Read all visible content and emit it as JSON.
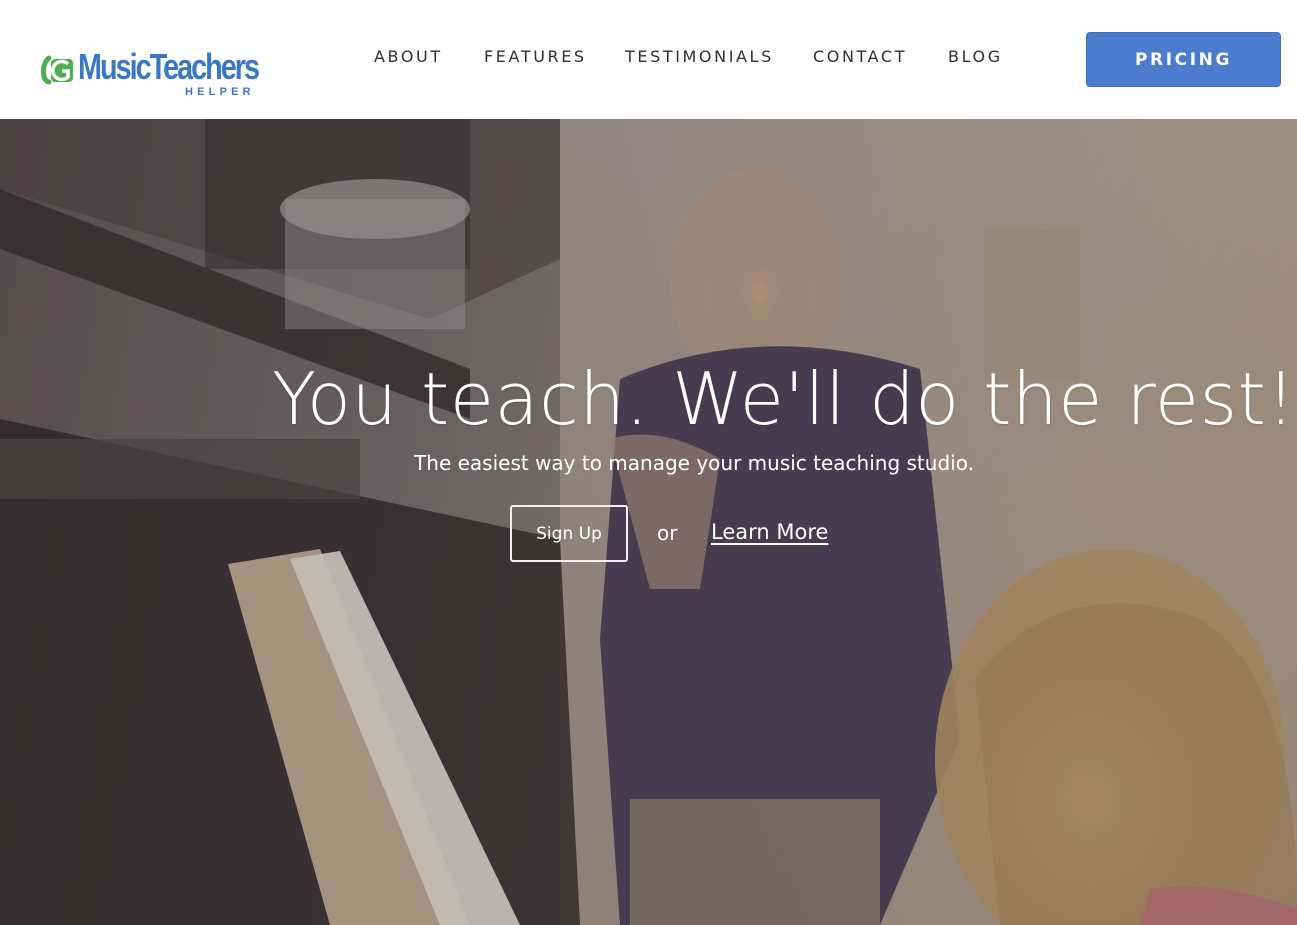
{
  "brand": {
    "name": "MusicTeachers",
    "tagline": "HELPER",
    "colors": {
      "primary_blue": "#3b78c4",
      "accent_green": "#4caf50"
    }
  },
  "nav": {
    "items": [
      {
        "label": "ABOUT"
      },
      {
        "label": "FEATURES"
      },
      {
        "label": "TESTIMONIALS"
      },
      {
        "label": "CONTACT"
      },
      {
        "label": "BLOG"
      }
    ],
    "cta_label": "PRICING",
    "cta_color": "#4b7ccd"
  },
  "hero": {
    "headline": "You teach. We'll do the rest!",
    "subheadline": "The easiest way to manage your music teaching studio.",
    "primary_button": "Sign Up",
    "separator": "or",
    "secondary_link": "Learn More",
    "background_image": "piano-lesson-photo"
  }
}
